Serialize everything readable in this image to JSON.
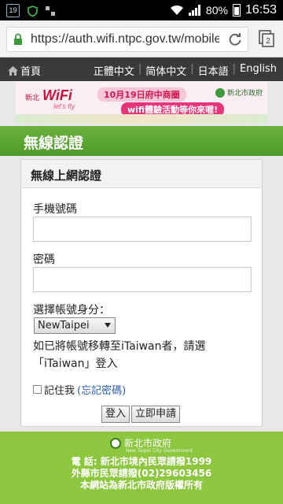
{
  "status_bar": {
    "calendar_day": "19",
    "battery": "80%",
    "time": "16:53"
  },
  "browser": {
    "url": "https://auth.wifi.ntpc.gov.tw/mobile",
    "tab_count": "2"
  },
  "site_nav": {
    "home": "首頁",
    "languages": [
      "正體中文",
      "简体中文",
      "日本語",
      "English"
    ]
  },
  "banner": {
    "brand": "WiFi",
    "tagline": "let's fly",
    "region": "新北",
    "date_text": "10月19日府中商圈",
    "event_text": "wifi體驗活動等你來喔!",
    "logo_text": "新北市政府"
  },
  "page_title": "無線認證",
  "form": {
    "heading": "無線上網認證",
    "phone_label": "手機號碼",
    "phone_value": "",
    "password_label": "密碼",
    "password_value": "",
    "account_label": "選擇帳號身分：",
    "account_selected": "NewTaipei",
    "note": "如已將帳號移轉至iTaiwan者，請選「iTaiwan」登入",
    "remember_label": "記住我",
    "forgot_label": "(忘記密碼)",
    "login_button": "登入",
    "register_button": "立即申請"
  },
  "footer": {
    "logo_text": "新北市政府",
    "logo_sub": "New Taipei City Government",
    "lines": [
      "電 話: 新北市境內民眾請撥1999",
      "外縣市民眾請撥(02)29603456",
      "本網站為新北市政府版權所有"
    ]
  },
  "colors": {
    "brand_green": "#6cb33f",
    "footer_green": "#8dc63f",
    "nav_dark": "#3a3a3a",
    "link": "#2a5db0"
  }
}
